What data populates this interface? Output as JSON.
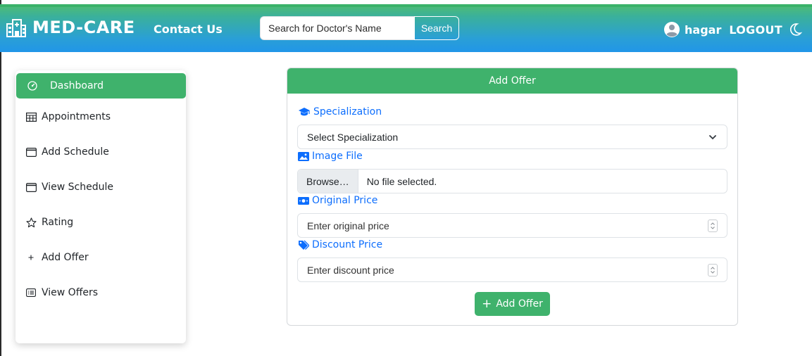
{
  "navbar": {
    "brand": "MED-CARE",
    "contact_label": "Contact Us",
    "search_placeholder": "Search for Doctor's Name",
    "search_button": "Search",
    "username": "hagar",
    "logout_label": "LOGOUT"
  },
  "sidebar": {
    "items": [
      {
        "label": "Dashboard",
        "icon": "speedometer-icon",
        "active": true
      },
      {
        "label": "Appointments",
        "icon": "table-icon"
      },
      {
        "label": "Add Schedule",
        "icon": "calendar-icon"
      },
      {
        "label": "View Schedule",
        "icon": "calendar-icon"
      },
      {
        "label": "Rating",
        "icon": "star-icon"
      },
      {
        "label": "Add Offer",
        "icon": "plus-icon"
      },
      {
        "label": "View Offers",
        "icon": "card-list-icon"
      }
    ]
  },
  "form": {
    "header": "Add Offer",
    "specialization_label": "Specialization",
    "specialization_selected": "Select Specialization",
    "image_label": "Image File",
    "browse_label": "Browse…",
    "file_status": "No file selected.",
    "original_price_label": "Original Price",
    "original_price_placeholder": "Enter original price",
    "discount_price_label": "Discount Price",
    "discount_price_placeholder": "Enter discount price",
    "submit_label": "Add Offer"
  },
  "colors": {
    "accent_green": "#3fb26c",
    "nav_blue": "#2196e8",
    "link_blue": "#0d6efd"
  }
}
